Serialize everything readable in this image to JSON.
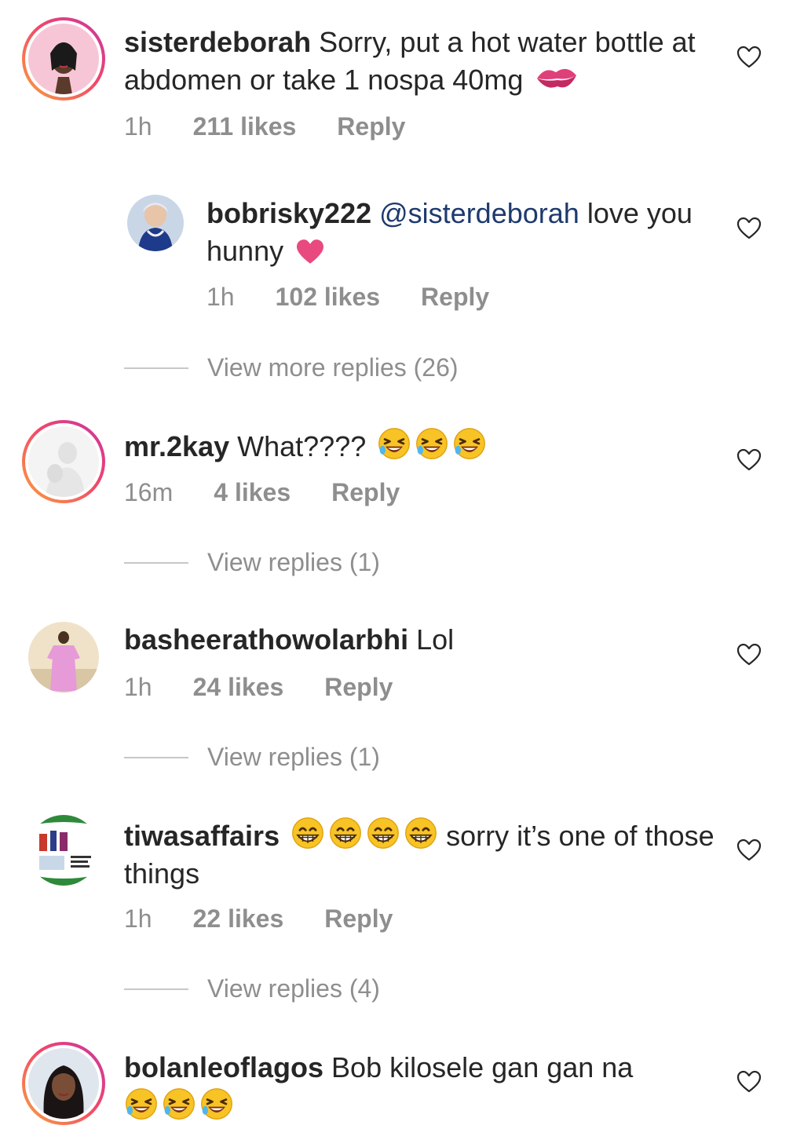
{
  "comments": [
    {
      "username": "sisterdeborah",
      "text": " Sorry, put a hot water bottle at abdomen or take 1 nospa 40mg",
      "time": "1h",
      "likes": "211 likes",
      "reply": "Reply",
      "emoji": "kiss-mark"
    },
    {
      "username": "bobrisky222",
      "mention": " @sisterdeborah",
      "text": " love you hunny",
      "time": "1h",
      "likes": "102 likes",
      "reply": "Reply",
      "emoji": "pink-heart"
    },
    {
      "username": "mr.2kay",
      "text": " What????",
      "time": "16m",
      "likes": "4 likes",
      "reply": "Reply",
      "emoji": "laughing-face x3"
    },
    {
      "username": "basheerathowolarbhi",
      "text": " Lol",
      "time": "1h",
      "likes": "24 likes",
      "reply": "Reply"
    },
    {
      "username": "tiwasaffairs",
      "text": " sorry it’s one of those things",
      "time": "1h",
      "likes": "22 likes",
      "reply": "Reply",
      "emoji": "grinning-face x4"
    },
    {
      "username": "bolanleoflagos",
      "text": " Bob kilosele gan gan na",
      "emoji": "laughing-face x3"
    }
  ],
  "view_replies": [
    "View more replies (26)",
    "View replies (1)",
    "View replies (1)",
    "View replies (4)"
  ],
  "colors": {
    "text": "#262626",
    "muted": "#8e8e8e",
    "mention": "#1e3a6e",
    "story_ring_start": "#f9a23c",
    "story_ring_end": "#c535a6",
    "heart_emoji": "#e84a7f"
  }
}
